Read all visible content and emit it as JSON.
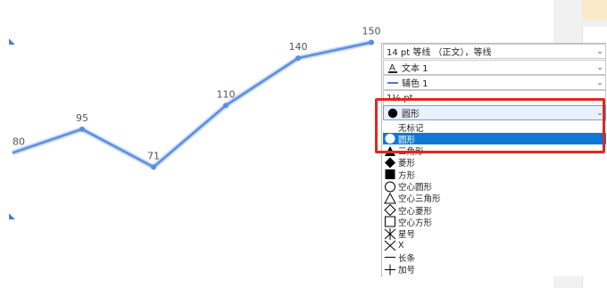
{
  "chart_data": {
    "type": "line",
    "x": [
      1,
      2,
      3,
      4,
      5,
      6
    ],
    "values": [
      80,
      95,
      71,
      110,
      140,
      150
    ],
    "data_labels": [
      "80",
      "95",
      "71",
      "110",
      "140",
      "150"
    ],
    "series_color": "#5b8de0",
    "ylim": [
      0,
      180
    ],
    "grid": false,
    "title": "",
    "xlabel": "",
    "ylabel": ""
  },
  "panel": {
    "line_weight": "14 pt 等线 （正文），等线",
    "font_color": "文本 1",
    "line_color": "辅色 1",
    "size_partial": "1½ pt",
    "marker_selected": "圆形",
    "marker_options": [
      {
        "label": "无标记",
        "icon": "none-icon"
      },
      {
        "label": "圆形",
        "icon": "circle-filled-icon"
      },
      {
        "label": "三角形",
        "icon": "triangle-filled-icon"
      },
      {
        "label": "菱形",
        "icon": "diamond-filled-icon"
      },
      {
        "label": "方形",
        "icon": "square-filled-icon"
      },
      {
        "label": "空心圆形",
        "icon": "circle-outline-icon"
      },
      {
        "label": "空心三角形",
        "icon": "triangle-outline-icon"
      },
      {
        "label": "空心菱形",
        "icon": "diamond-outline-icon"
      },
      {
        "label": "空心方形",
        "icon": "square-outline-icon"
      },
      {
        "label": "星号",
        "icon": "asterisk-icon"
      },
      {
        "label": "X",
        "icon": "x-mark-icon"
      },
      {
        "label": "长条",
        "icon": "dash-icon"
      },
      {
        "label": "加号",
        "icon": "plus-icon"
      }
    ],
    "selected_index": 1,
    "accent_color": "#0f78d4",
    "highlight_color": "#e0281e"
  }
}
